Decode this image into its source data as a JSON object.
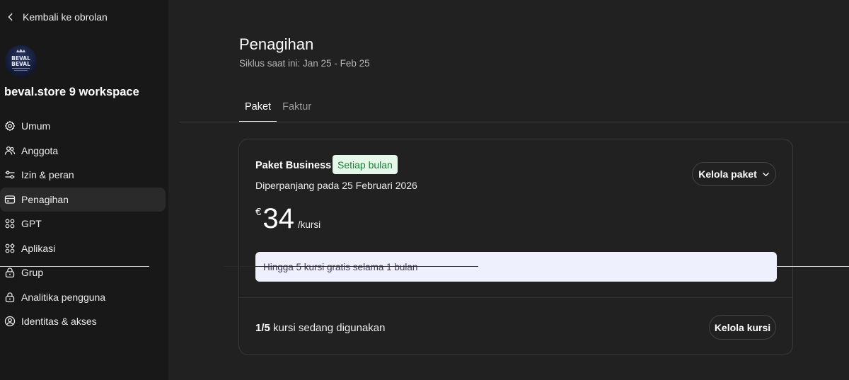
{
  "sidebar": {
    "back_label": "Kembali ke obrolan",
    "workspace_name": "beval.store 9 workspace",
    "avatar_text": "BEVAL",
    "items": [
      {
        "label": "Umum",
        "icon": "gear-icon"
      },
      {
        "label": "Anggota",
        "icon": "people-icon"
      },
      {
        "label": "Izin & peran",
        "icon": "sliders-icon"
      },
      {
        "label": "Penagihan",
        "icon": "credit-card-icon",
        "active": true
      },
      {
        "label": "GPT",
        "icon": "grid-dots-icon"
      },
      {
        "label": "Aplikasi",
        "icon": "apps-icon"
      },
      {
        "label": "Grup",
        "icon": "lock-icon"
      },
      {
        "label": "Analitika pengguna",
        "icon": "lock-icon"
      },
      {
        "label": "Identitas & akses",
        "icon": "user-circle-icon"
      }
    ]
  },
  "main": {
    "title": "Penagihan",
    "subtitle": "Siklus saat ini: Jan 25 - Feb 25",
    "tabs": [
      {
        "label": "Paket",
        "active": true
      },
      {
        "label": "Faktur",
        "active": false
      }
    ],
    "plan": {
      "name": "Paket Business",
      "badge": "Setiap bulan",
      "renewal": "Diperpanjang pada 25 Februari 2026",
      "manage_label": "Kelola paket",
      "currency": "€",
      "amount": "34",
      "unit": "/kursi",
      "promo": "Hingga 5 kursi gratis selama 1 bulan",
      "seats_count": "1/5",
      "seats_text": " kursi sedang digunakan",
      "manage_seats_label": "Kelola kursi"
    }
  },
  "colors": {
    "background": "#212121",
    "sidebar": "#181818",
    "badge_bg": "#e5f7e8",
    "badge_text": "#1a7f37",
    "promo_bg": "#eef0fd"
  }
}
